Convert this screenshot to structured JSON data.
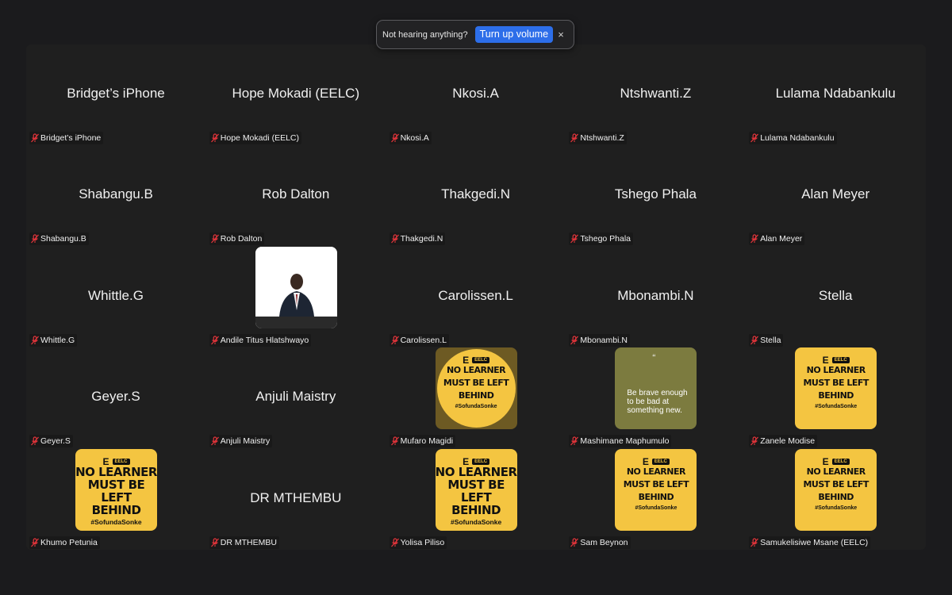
{
  "notification": {
    "text": "Not hearing anything?",
    "button_label": "Turn up volume",
    "close_icon": "close-icon",
    "close_glyph": "×"
  },
  "colors": {
    "background": "#1b1b1d",
    "panel": "#1f1f1f",
    "accent_button": "#2d6ee9",
    "mute_icon": "#e0343a",
    "poster_yellow": "#f4c541"
  },
  "poster": {
    "logo_letter": "E",
    "badge": "EELC",
    "lines": [
      "NO LEARNER",
      "MUST BE LEFT",
      "BEHIND"
    ],
    "hashtag": "#SofundaSonke"
  },
  "quote": {
    "mark": "“",
    "text": "Be brave enough to be bad at something new."
  },
  "participants": [
    {
      "name": "Bridget’s iPhone",
      "label": "Bridget’s iPhone"
    },
    {
      "name": "Hope Mokadi (EELC)",
      "label": "Hope Mokadi (EELC)"
    },
    {
      "name": "Nkosi.A",
      "label": "Nkosi.A"
    },
    {
      "name": "Ntshwanti.Z",
      "label": "Ntshwanti.Z"
    },
    {
      "name": "Lulama Ndabankulu",
      "label": "Lulama Ndabankulu"
    },
    {
      "name": "Shabangu.B",
      "label": "Shabangu.B"
    },
    {
      "name": "Rob Dalton",
      "label": "Rob Dalton"
    },
    {
      "name": "Thakgedi.N",
      "label": "Thakgedi.N"
    },
    {
      "name": "Tshego Phala",
      "label": "Tshego Phala"
    },
    {
      "name": "Alan Meyer",
      "label": "Alan Meyer"
    },
    {
      "name": "Whittle.G",
      "label": "Whittle.G"
    },
    {
      "name": "",
      "label": "Andile Titus Hlatshwayo",
      "avatar": "photo"
    },
    {
      "name": "Carolissen.L",
      "label": "Carolissen.L"
    },
    {
      "name": "Mbonambi.N",
      "label": "Mbonambi.N"
    },
    {
      "name": "Stella",
      "label": "Stella"
    },
    {
      "name": "Geyer.S",
      "label": "Geyer.S"
    },
    {
      "name": "Anjuli Maistry",
      "label": "Anjuli Maistry"
    },
    {
      "name": "",
      "label": "Mufaro Magidi",
      "avatar": "poster-dim"
    },
    {
      "name": "",
      "label": "Mashimane Maphumulo",
      "avatar": "quote"
    },
    {
      "name": "",
      "label": "Zanele Modise",
      "avatar": "poster"
    },
    {
      "name": "",
      "label": "Khumo Petunia",
      "avatar": "poster-large"
    },
    {
      "name": "DR MTHEMBU",
      "label": "DR MTHEMBU"
    },
    {
      "name": "",
      "label": "Yolisa Piliso",
      "avatar": "poster-large"
    },
    {
      "name": "",
      "label": "Sam Beynon",
      "avatar": "poster"
    },
    {
      "name": "",
      "label": "Samukelisiwe Msane (EELC)",
      "avatar": "poster"
    }
  ]
}
